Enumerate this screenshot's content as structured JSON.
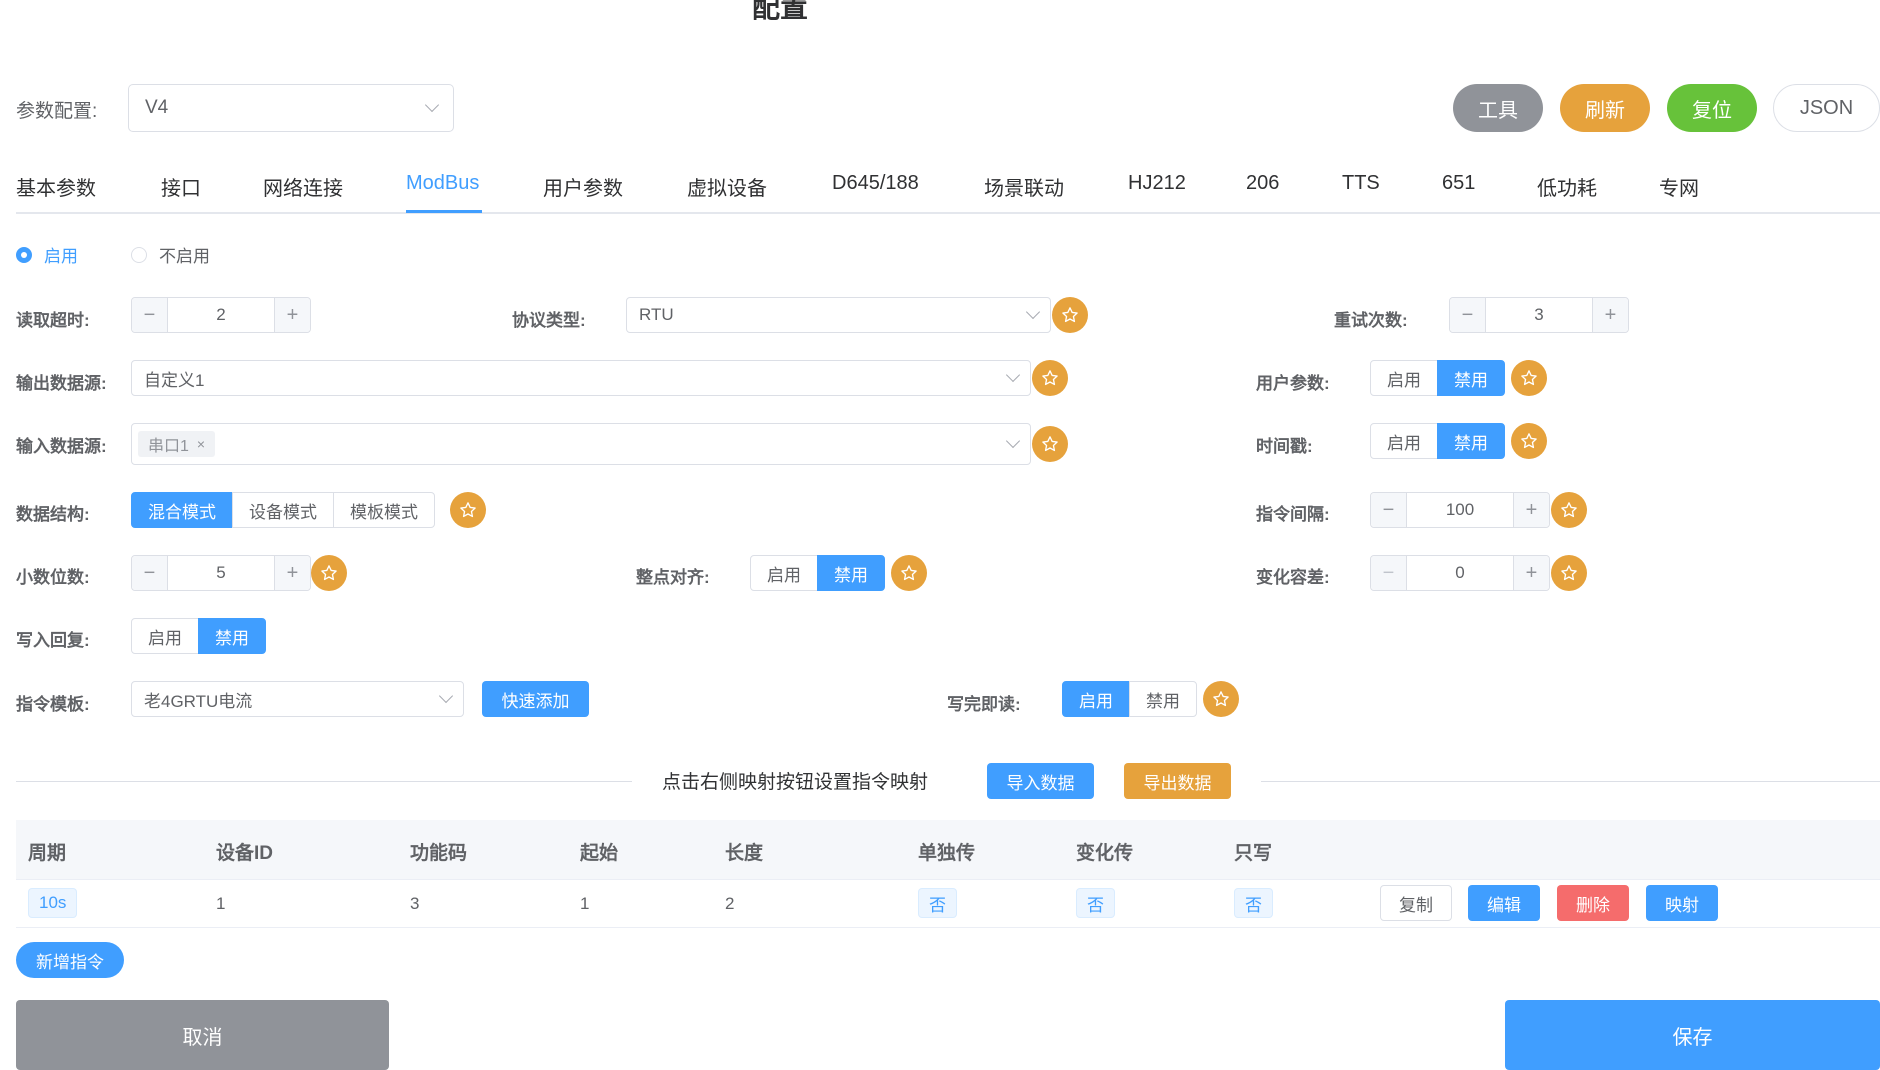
{
  "page_title": "配置",
  "header": {
    "config_label": "参数配置:",
    "config_value": "V4",
    "tools_label": "工具",
    "refresh_label": "刷新",
    "reset_label": "复位",
    "json_label": "JSON"
  },
  "tabs": [
    "基本参数",
    "接口",
    "网络连接",
    "ModBus",
    "用户参数",
    "虚拟设备",
    "D645/188",
    "场景联动",
    "HJ212",
    "206",
    "TTS",
    "651",
    "低功耗",
    "专网"
  ],
  "enable_radio": {
    "on": "启用",
    "off": "不启用"
  },
  "fields": {
    "read_timeout": {
      "label": "读取超时:",
      "value": "2"
    },
    "protocol": {
      "label": "协议类型:",
      "value": "RTU"
    },
    "retries": {
      "label": "重试次数:",
      "value": "3"
    },
    "output_source": {
      "label": "输出数据源:",
      "value": "自定义1"
    },
    "user_params": {
      "label": "用户参数:",
      "enable": "启用",
      "disable": "禁用"
    },
    "input_source": {
      "label": "输入数据源:",
      "tag": "串口1",
      "tag_close": "×"
    },
    "timestamp": {
      "label": "时间戳:",
      "enable": "启用",
      "disable": "禁用"
    },
    "data_struct": {
      "label": "数据结构:",
      "options": [
        "混合模式",
        "设备模式",
        "模板模式"
      ]
    },
    "cmd_interval": {
      "label": "指令间隔:",
      "value": "100"
    },
    "decimals": {
      "label": "小数位数:",
      "value": "5"
    },
    "on_hour": {
      "label": "整点对齐:",
      "enable": "启用",
      "disable": "禁用"
    },
    "change_tolerance": {
      "label": "变化容差:",
      "value": "0"
    },
    "write_reply": {
      "label": "写入回复:",
      "enable": "启用",
      "disable": "禁用"
    },
    "cmd_template": {
      "label": "指令模板:",
      "value": "老4GRTU电流",
      "quick_add": "快速添加"
    },
    "read_after_write": {
      "label": "写完即读:",
      "enable": "启用",
      "disable": "禁用"
    }
  },
  "divider": {
    "text": "点击右侧映射按钮设置指令映射",
    "import": "导入数据",
    "export": "导出数据"
  },
  "table": {
    "headers": [
      "周期",
      "设备ID",
      "功能码",
      "起始",
      "长度",
      "单独传",
      "变化传",
      "只写"
    ],
    "row": {
      "period": "10s",
      "device_id": "1",
      "func_code": "3",
      "start": "1",
      "length": "2",
      "single": "否",
      "change": "否",
      "write_only": "否",
      "copy": "复制",
      "edit": "编辑",
      "delete": "删除",
      "map": "映射"
    }
  },
  "add_command": "新增指令",
  "footer": {
    "cancel": "取消",
    "save": "保存"
  },
  "icons": {
    "star": "star-icon",
    "chevron": "chevron-down-icon",
    "minus": "−",
    "plus": "+"
  },
  "colors": {
    "primary": "#409eff",
    "warning": "#e6a23c",
    "success": "#67c23a",
    "info": "#909399",
    "danger": "#f56c6c"
  }
}
